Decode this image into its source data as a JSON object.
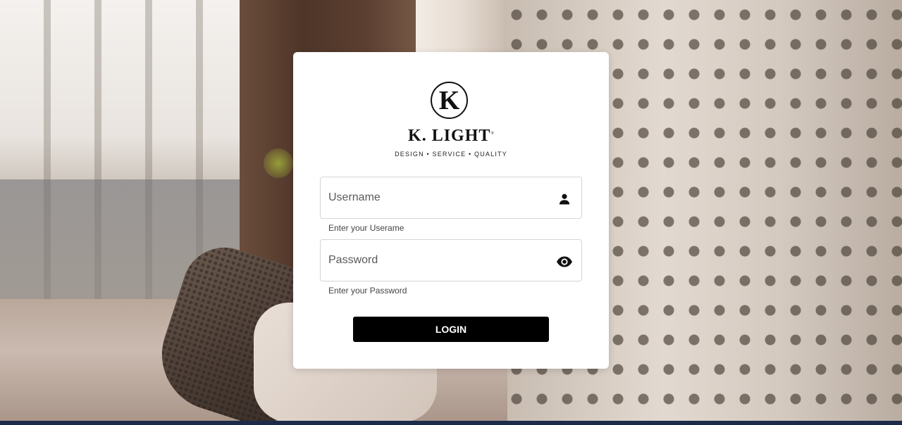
{
  "brand": {
    "logo_letter": "K",
    "name": "K. LIGHT",
    "registered_mark": "®",
    "tagline": "DESIGN • SERVICE • QUALITY"
  },
  "login_form": {
    "username": {
      "placeholder": "Username",
      "value": "",
      "hint": "Enter your Userame",
      "icon": "person-icon"
    },
    "password": {
      "placeholder": "Password",
      "value": "",
      "hint": "Enter your Password",
      "icon": "eye-icon"
    },
    "submit_label": "LOGIN"
  },
  "colors": {
    "button_bg": "#000000",
    "button_text": "#ffffff",
    "card_bg": "#ffffff"
  }
}
